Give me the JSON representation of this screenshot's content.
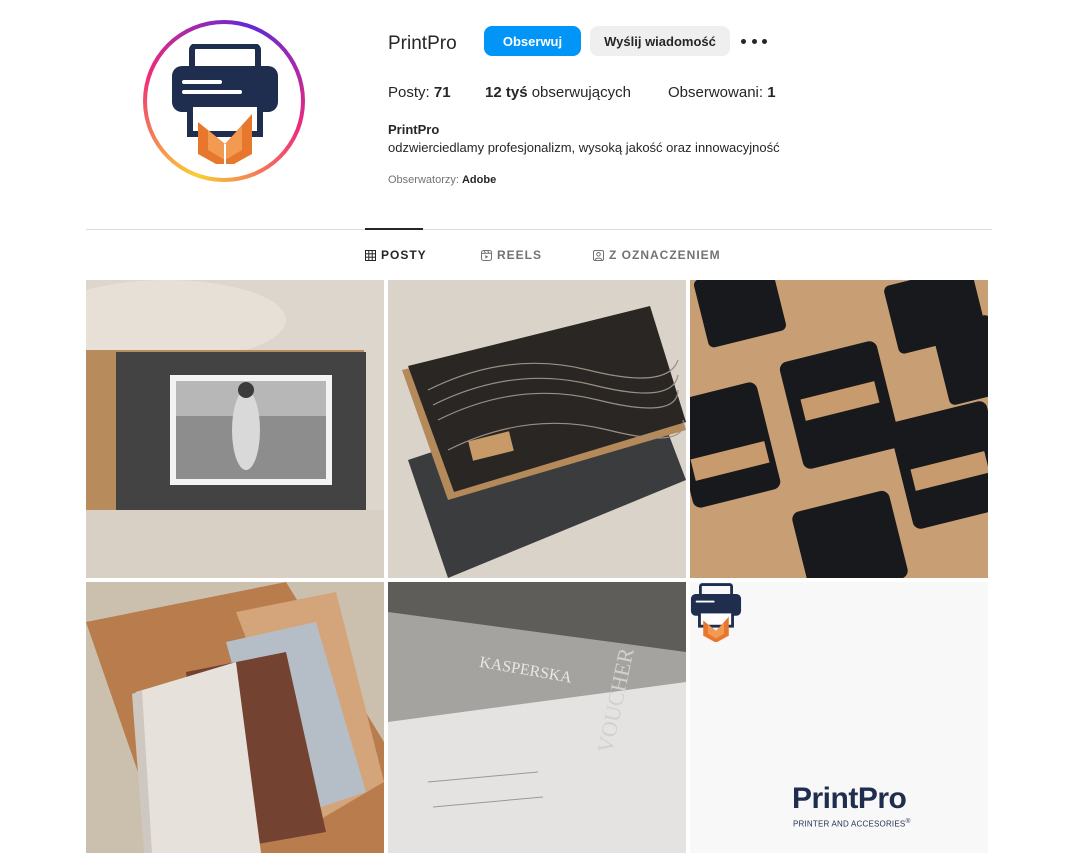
{
  "profile": {
    "username": "PrintPro",
    "follow_label": "Obserwuj",
    "message_label": "Wyślij wiadomość",
    "more_icon": "ellipsis-icon"
  },
  "stats": {
    "posts_label": "Posty:",
    "posts_value": "71",
    "followers_value": "12 tyś",
    "followers_label": "obserwujących",
    "following_label": "Obserwowani:",
    "following_value": "1"
  },
  "bio": {
    "name": "PrintPro",
    "text": "odzwierciedlamy profesjonalizm, wysoką jakość oraz innowacyjność",
    "followed_by_label": "Obserwatorzy:",
    "followed_by_name": "Adobe"
  },
  "tabs": [
    {
      "label": "POSTY",
      "icon": "grid-icon",
      "active": true
    },
    {
      "label": "REELS",
      "icon": "reels-icon",
      "active": false
    },
    {
      "label": "Z OZNACZENIEM",
      "icon": "tagged-icon",
      "active": false
    }
  ],
  "brand_tile": {
    "name": "PrintPro",
    "tagline": "PRINTER AND ACCESORIES",
    "mark": "®"
  },
  "colors": {
    "accent": "#0095f6",
    "brand_navy": "#1f2e4f",
    "brand_orange": "#e8772e"
  }
}
